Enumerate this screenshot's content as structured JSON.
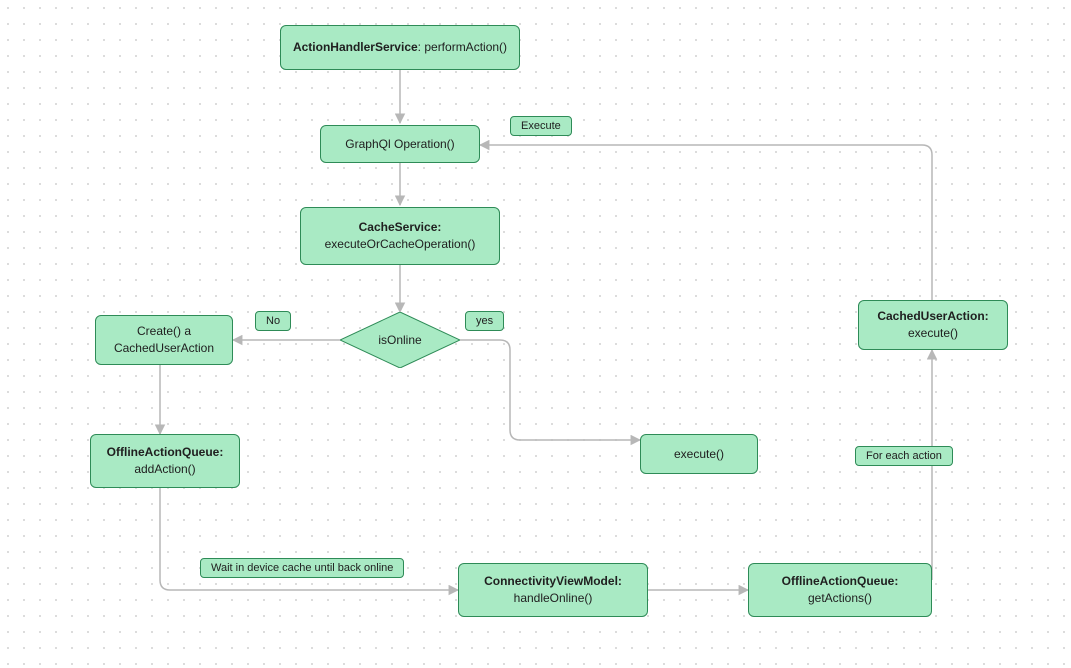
{
  "nodes": {
    "action_handler": {
      "bold": "ActionHandlerService",
      "plain": ": performAction()"
    },
    "graphql": {
      "plain": "GraphQl Operation()"
    },
    "cache_service": {
      "bold": "CacheService:",
      "plain": "executeOrCacheOperation()"
    },
    "is_online": {
      "plain": "isOnline"
    },
    "create_cached": {
      "line1": "Create() a",
      "line2": "CachedUserAction"
    },
    "offline_add": {
      "bold": "OfflineActionQueue:",
      "plain": "addAction()"
    },
    "connectivity": {
      "bold": "ConnectivityViewModel:",
      "plain": "handleOnline()"
    },
    "offline_get": {
      "bold": "OfflineActionQueue:",
      "plain": "getActions()"
    },
    "cached_exec": {
      "bold": "CachedUserAction:",
      "plain": "execute()"
    },
    "exec": {
      "plain": "execute()"
    }
  },
  "labels": {
    "no": "No",
    "yes": "yes",
    "execute": "Execute",
    "wait": "Wait in device cache until back online",
    "for_each": "For each action"
  },
  "colors": {
    "node_fill": "#a9eac4",
    "node_stroke": "#2e8b57",
    "edge": "#b7b7b7"
  }
}
